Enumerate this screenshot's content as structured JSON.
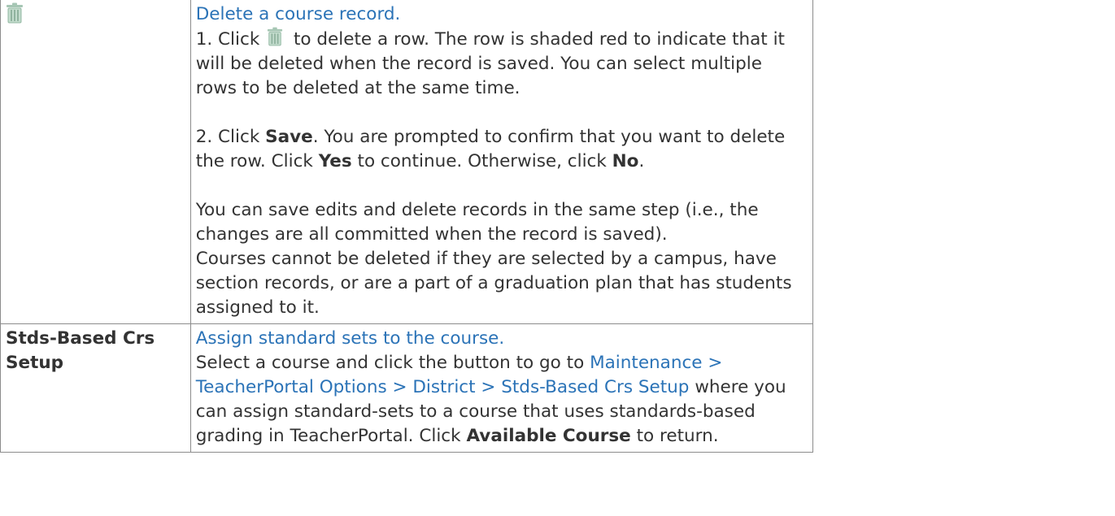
{
  "rows": [
    {
      "icon": "trash-icon",
      "link": "Delete a course record.",
      "step1_prefix": "1. Click",
      "step1_suffix": "to delete a row. The row is shaded red to indicate that it will be deleted when the record is saved. You can select multiple rows to be deleted at the same time.",
      "step2_prefix": "2. Click",
      "step2_save": "Save",
      "step2_middle": ". You are prompted to confirm that you want to delete the row. Click",
      "step2_yes": "Yes",
      "step2_after_yes": "to continue. Otherwise, click",
      "step2_no": "No",
      "step2_end": ".",
      "note1": "You can save edits and delete records in the same step (i.e., the changes are all committed when the record is saved).",
      "note2": "Courses cannot be deleted if they are selected by a campus, have section records, or are a part of a graduation plan that has students assigned to it."
    },
    {
      "label": "Stds-Based Crs Setup",
      "link": "Assign standard sets to the course.",
      "text_prefix": "Select a course and click the button to go to",
      "nav_link": "Maintenance > TeacherPortal Options > District > Stds-Based Crs Setup",
      "text_middle": "where you can assign standard-sets to a course that uses standards-based grading in TeacherPortal. Click",
      "text_bold": "Available Course",
      "text_end": "to return."
    }
  ],
  "colors": {
    "link": "#2b73b7",
    "text": "#333333",
    "border": "#8c8c8c",
    "icon": "#a6c6b4"
  }
}
